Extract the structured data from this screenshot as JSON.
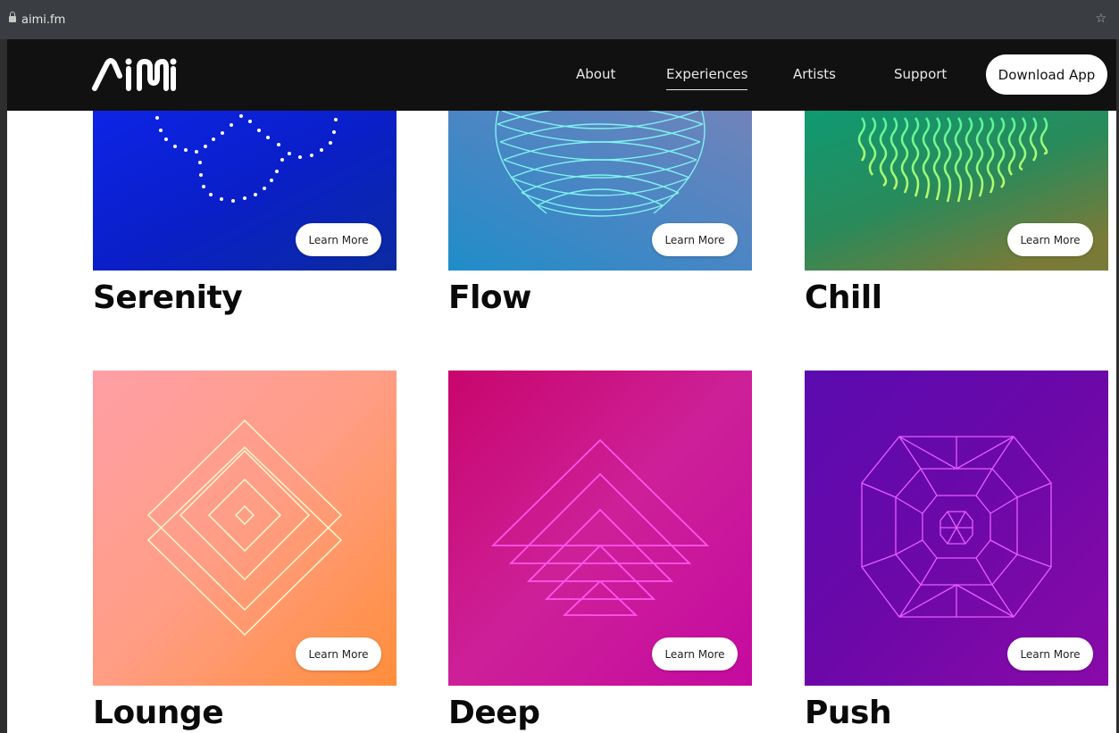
{
  "browser": {
    "url": "aimi.fm"
  },
  "nav": {
    "links": [
      {
        "label": "About"
      },
      {
        "label": "Experiences"
      },
      {
        "label": "Artists"
      },
      {
        "label": "Support"
      }
    ],
    "download_label": "Download App"
  },
  "cards": [
    {
      "title": "Serenity",
      "button": "Learn More",
      "gradient": [
        "#0a1fd8",
        "#0b2aa8"
      ]
    },
    {
      "title": "Flow",
      "button": "Learn More",
      "gradient": [
        "#2f8fc6",
        "#6a86bd"
      ]
    },
    {
      "title": "Chill",
      "button": "Learn More",
      "gradient": [
        "#1c8c66",
        "#6b7a3a"
      ]
    },
    {
      "title": "Lounge",
      "button": "Learn More",
      "gradient": [
        "#ff9c9c",
        "#ff9a4d"
      ]
    },
    {
      "title": "Deep",
      "button": "Learn More",
      "gradient": [
        "#c70a73",
        "#c5139a"
      ]
    },
    {
      "title": "Push",
      "button": "Learn More",
      "gradient": [
        "#5b0aa8",
        "#8a0aa6"
      ]
    }
  ]
}
